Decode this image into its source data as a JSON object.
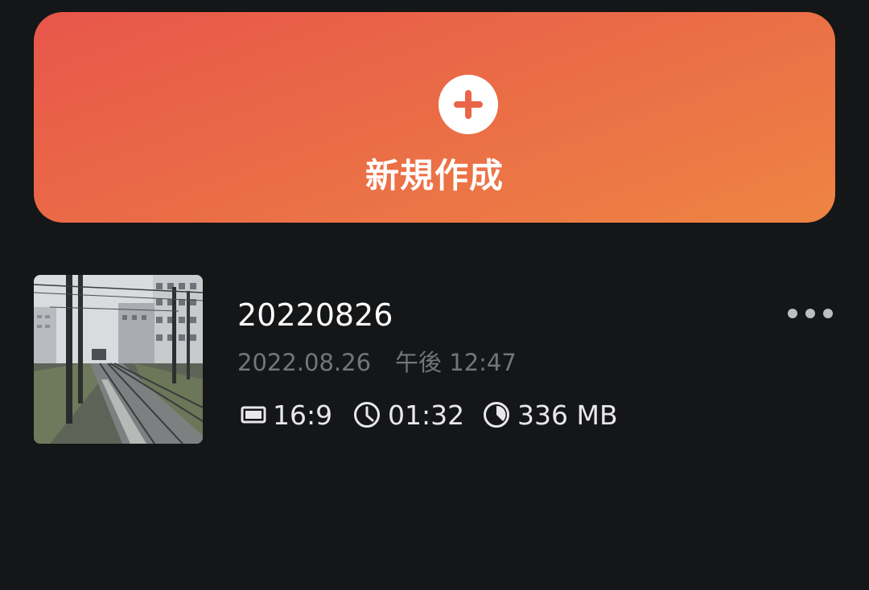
{
  "new_project": {
    "label": "新規作成",
    "icon": "plus-icon"
  },
  "project": {
    "title": "20220826",
    "date": "2022.08.26",
    "time": "午後 12:47",
    "aspect_ratio": "16:9",
    "duration": "01:32",
    "size": "336 MB",
    "more_icon": "more-horizontal-icon"
  }
}
